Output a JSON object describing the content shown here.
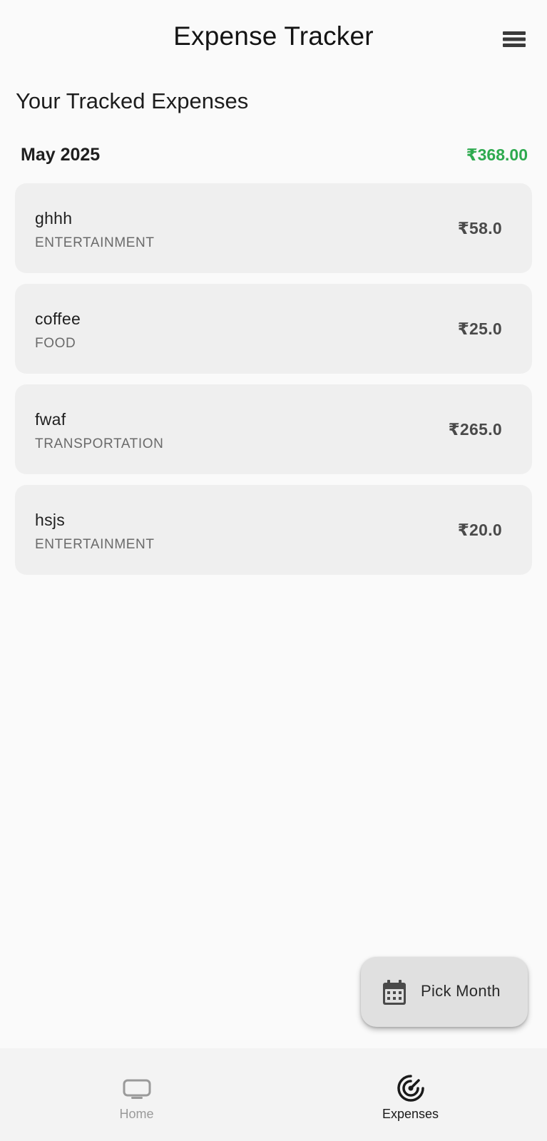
{
  "colors": {
    "background": "#fafafa",
    "card": "#efefef",
    "total_green": "#2eaa4f",
    "nav_bg": "#f3f3f3"
  },
  "header": {
    "title": "Expense Tracker",
    "menu_icon": "hamburger-menu-icon"
  },
  "main": {
    "section_title": "Your Tracked Expenses",
    "month_label": "May 2025",
    "month_total": "₹368.00",
    "expenses": [
      {
        "name": "ghhh",
        "category": "ENTERTAINMENT",
        "amount": "₹58.0"
      },
      {
        "name": "coffee",
        "category": "FOOD",
        "amount": "₹25.0"
      },
      {
        "name": "fwaf",
        "category": "TRANSPORTATION",
        "amount": "₹265.0"
      },
      {
        "name": "hsjs",
        "category": "ENTERTAINMENT",
        "amount": "₹20.0"
      }
    ]
  },
  "fab": {
    "label": "Pick Month",
    "icon": "calendar-icon"
  },
  "bottom_nav": {
    "items": [
      {
        "label": "Home",
        "icon": "tv-icon",
        "active": false
      },
      {
        "label": "Expenses",
        "icon": "radar-icon",
        "active": true
      }
    ]
  }
}
